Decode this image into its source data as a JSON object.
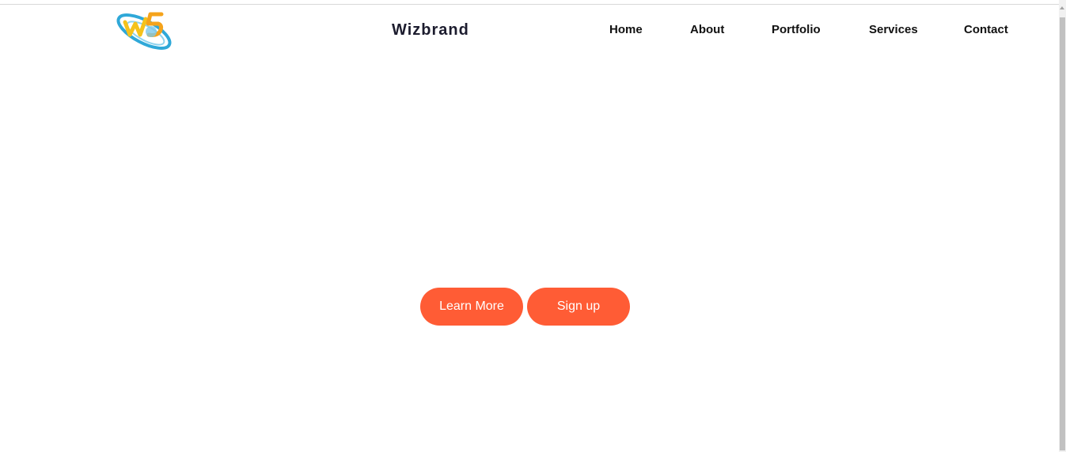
{
  "header": {
    "brand_name": "Wizbrand",
    "logo_icon": "wizbrand-logo-icon"
  },
  "nav": {
    "items": [
      {
        "label": "Home"
      },
      {
        "label": "About"
      },
      {
        "label": "Portfolio"
      },
      {
        "label": "Services"
      },
      {
        "label": "Contact"
      }
    ]
  },
  "hero": {
    "learn_more_label": "Learn More",
    "sign_up_label": "Sign up"
  },
  "colors": {
    "accent": "#ff5c35",
    "logo_blue": "#2fa8d8",
    "logo_yellow": "#f5c21b",
    "brand_text": "#1c1c2e"
  }
}
